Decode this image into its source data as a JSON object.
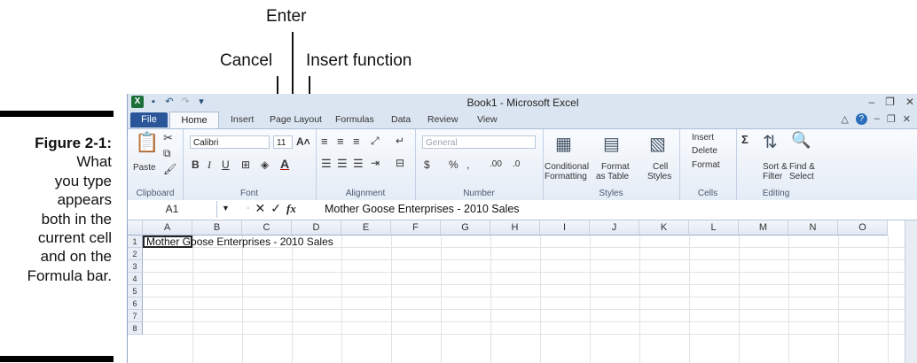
{
  "callouts": {
    "enter": "Enter",
    "cancel": "Cancel",
    "insert_function": "Insert function"
  },
  "caption": {
    "figure": "Figure 2-1:",
    "lines": [
      "What",
      "you type",
      "appears",
      "both in the",
      "current cell",
      "and on the",
      "Formula bar."
    ]
  },
  "window": {
    "title": "Book1 - Microsoft Excel"
  },
  "tabs": [
    "File",
    "Home",
    "Insert",
    "Page Layout",
    "Formulas",
    "Data",
    "Review",
    "View"
  ],
  "ribbon": {
    "clipboard": {
      "label": "Clipboard",
      "paste": "Paste"
    },
    "font": {
      "label": "Font",
      "name": "Calibri",
      "size": "11",
      "bold": "B",
      "italic": "I",
      "underline": "U"
    },
    "alignment": {
      "label": "Alignment"
    },
    "number": {
      "label": "Number",
      "format": "General",
      "currency": "$",
      "percent": "%",
      "comma": ",",
      "inc": ".00",
      "dec": ".0"
    },
    "styles": {
      "label": "Styles",
      "cond": "Conditional",
      "cond2": "Formatting",
      "fmt": "Format",
      "fmt2": "as Table",
      "cell": "Cell",
      "cell2": "Styles"
    },
    "cells": {
      "label": "Cells",
      "insert": "Insert",
      "delete": "Delete",
      "format": "Format"
    },
    "editing": {
      "label": "Editing",
      "sort": "Sort &",
      "sort2": "Filter",
      "find": "Find &",
      "find2": "Select",
      "sigma": "Σ"
    }
  },
  "formula_bar": {
    "name_box": "A1",
    "fx": "fx",
    "content": "Mother Goose Enterprises - 2010 Sales"
  },
  "columns": [
    "A",
    "B",
    "C",
    "D",
    "E",
    "F",
    "G",
    "H",
    "I",
    "J",
    "K",
    "L",
    "M",
    "N",
    "O"
  ],
  "rows": [
    "1",
    "2",
    "3",
    "4",
    "5",
    "6",
    "7",
    "8"
  ],
  "cell_a1": "Mother Goose Enterprises - 2010 Sales",
  "colors": {
    "file_tab": "#2a5699",
    "ribbon": "#e4ecf6",
    "excel_green": "#1d6f3a"
  }
}
